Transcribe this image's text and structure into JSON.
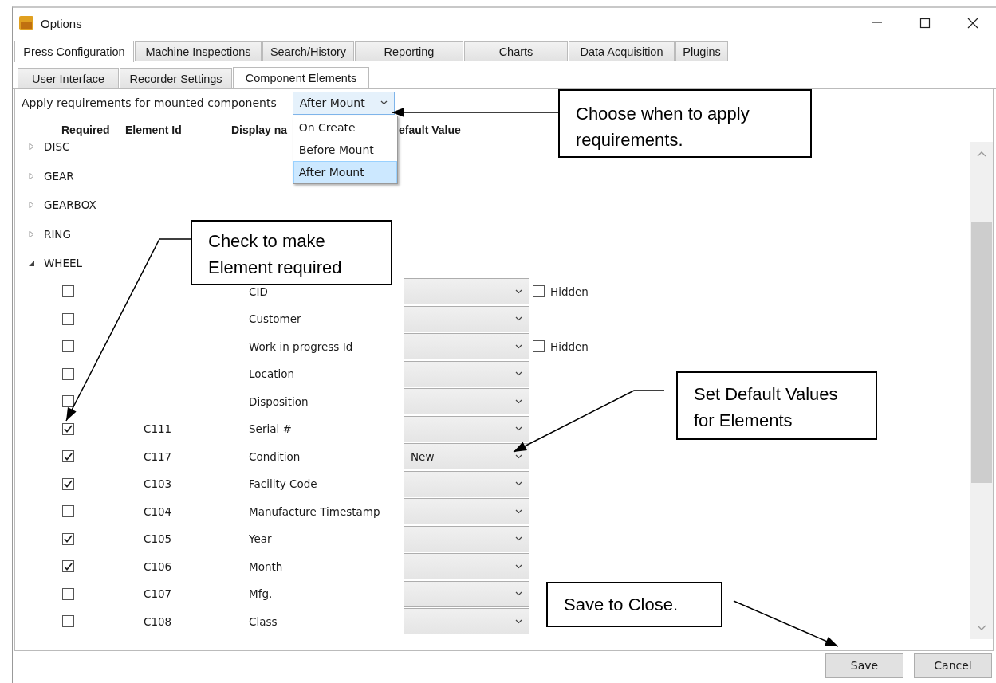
{
  "window": {
    "title": "Options"
  },
  "tabs": [
    {
      "label": "Press Configuration",
      "selected": true
    },
    {
      "label": "Machine Inspections",
      "selected": false
    },
    {
      "label": "Search/History",
      "selected": false
    },
    {
      "label": "Reporting",
      "selected": false
    },
    {
      "label": "Charts",
      "selected": false
    },
    {
      "label": "Data Acquisition",
      "selected": false
    },
    {
      "label": "Plugins",
      "selected": false
    }
  ],
  "subtabs": [
    {
      "label": "User Interface",
      "selected": false
    },
    {
      "label": "Recorder Settings",
      "selected": false
    },
    {
      "label": "Component Elements",
      "selected": true
    }
  ],
  "apply": {
    "label": "Apply requirements for mounted components",
    "value": "After Mount",
    "expanded": true,
    "options": [
      {
        "label": "On Create",
        "selected": false
      },
      {
        "label": "Before Mount",
        "selected": false
      },
      {
        "label": "After Mount",
        "selected": true
      }
    ]
  },
  "columns": [
    "Required",
    "Element Id",
    "Display na",
    "efault Value"
  ],
  "tree": [
    {
      "label": "DISC",
      "expanded": false
    },
    {
      "label": "GEAR",
      "expanded": false
    },
    {
      "label": "GEARBOX",
      "expanded": false
    },
    {
      "label": "RING",
      "expanded": false
    },
    {
      "label": "WHEEL",
      "expanded": true,
      "children": [
        {
          "required": false,
          "name": "CID",
          "hidden": {
            "label": "Hidden",
            "checked": false
          }
        },
        {
          "required": false,
          "name": "Customer"
        },
        {
          "required": false,
          "name": "Work in progress Id",
          "hidden": {
            "label": "Hidden",
            "checked": false
          }
        },
        {
          "required": false,
          "name": "Location"
        },
        {
          "required": false,
          "name": "Disposition"
        },
        {
          "required": true,
          "id": "C111",
          "name": "Serial #"
        },
        {
          "required": true,
          "id": "C117",
          "name": "Condition",
          "default": "New"
        },
        {
          "required": true,
          "id": "C103",
          "name": "Facility Code"
        },
        {
          "required": false,
          "id": "C104",
          "name": "Manufacture Timestamp"
        },
        {
          "required": true,
          "id": "C105",
          "name": "Year"
        },
        {
          "required": true,
          "id": "C106",
          "name": "Month"
        },
        {
          "required": false,
          "id": "C107",
          "name": "Mfg."
        },
        {
          "required": false,
          "id": "C108",
          "name": "Class"
        }
      ]
    }
  ],
  "buttons": [
    "Save",
    "Cancel"
  ],
  "callouts": [
    {
      "text": "Choose when to apply requirements."
    },
    {
      "text": "Check to make Element required"
    },
    {
      "text": "Set Default Values for Elements"
    },
    {
      "text": "Save to Close."
    }
  ]
}
